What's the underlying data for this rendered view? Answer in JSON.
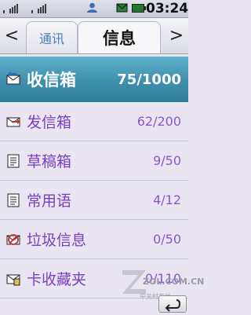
{
  "status": {
    "time": "03:24",
    "icons": [
      "signal-icon",
      "signal-icon",
      "contact-icon",
      "message-icon",
      "battery-icon"
    ]
  },
  "tabs": {
    "left_arrow": "<",
    "right_arrow": ">",
    "inactive_label": "通讯",
    "active_label": "信息"
  },
  "folders": [
    {
      "label": "收信箱",
      "count": "75/1000",
      "icon": "inbox-icon"
    },
    {
      "label": "发信箱",
      "count": "62/200",
      "icon": "outbox-icon"
    },
    {
      "label": "草稿箱",
      "count": "9/50",
      "icon": "draft-icon"
    },
    {
      "label": "常用语",
      "count": "4/12",
      "icon": "template-icon"
    },
    {
      "label": "垃圾信息",
      "count": "0/50",
      "icon": "spam-icon"
    },
    {
      "label": "卡收藏夹",
      "count": "0/110",
      "icon": "sim-folder-icon"
    }
  ],
  "watermark": {
    "site": "ZOL.COM.CN",
    "name": "中关村在线"
  },
  "colors": {
    "selected_row": "#3d8fad",
    "label_purple": "#7a3fc4",
    "tab_blue": "#4b7ec4"
  }
}
